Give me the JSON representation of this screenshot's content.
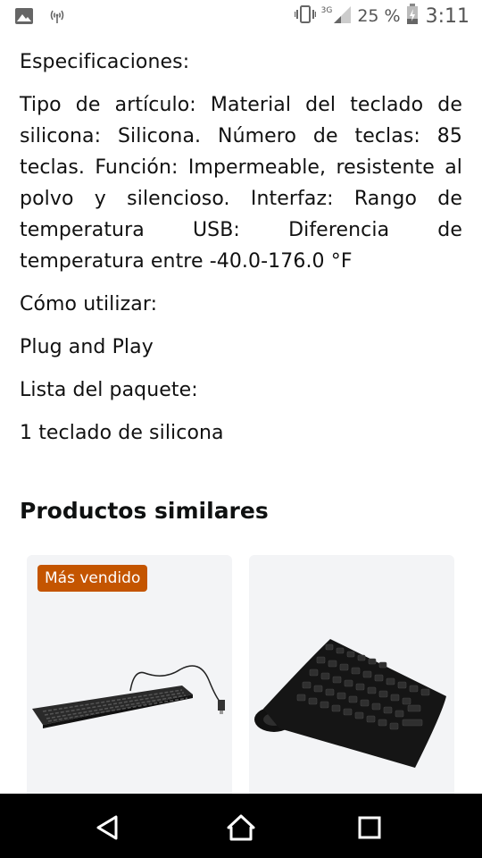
{
  "status_bar": {
    "network_label": "3G",
    "battery_percent": "25 %",
    "time": "3:11"
  },
  "product": {
    "specs_label": "Especificaciones:",
    "specs_text": "Tipo de artículo: Material del teclado de silicona: Silicona. Número de teclas: 85 teclas. Función: Impermeable, resistente al polvo y silencioso. Interfaz: Rango de temperatura USB: Diferencia de temperatura entre -40.0-176.0 °F",
    "how_to_use_label": "Cómo utilizar:",
    "how_to_use_text": "Plug and Play",
    "package_label": "Lista del paquete:",
    "package_text": "1 teclado de silicona"
  },
  "similar": {
    "heading": "Productos similares",
    "items": [
      {
        "badge": "Más vendido",
        "image_icon": "wired-keyboard"
      },
      {
        "badge": "",
        "image_icon": "flexible-silicone-keyboard"
      }
    ]
  },
  "icons": {
    "status_left": [
      "image-icon",
      "hotspot-icon"
    ],
    "status_right": [
      "vibrate-icon",
      "signal-icon",
      "battery-icon"
    ],
    "nav": [
      "back-icon",
      "home-icon",
      "recent-apps-icon"
    ]
  },
  "colors": {
    "badge_bg": "#c45500",
    "card_bg": "#f3f4f6",
    "nav_bg": "#000000",
    "text": "#111111"
  }
}
